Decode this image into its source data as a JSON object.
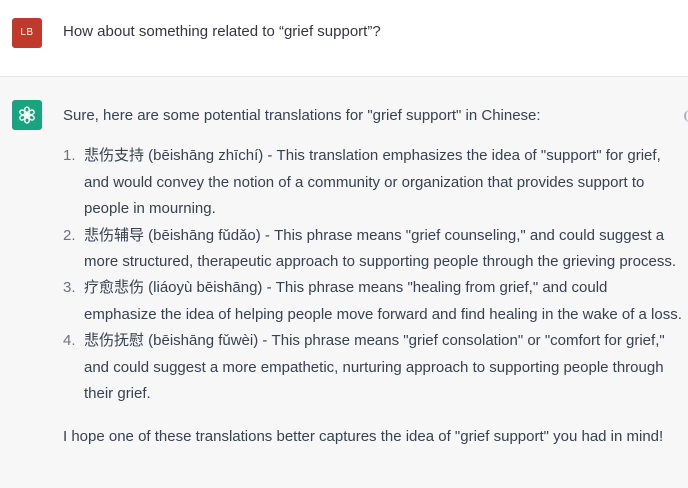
{
  "user_message": {
    "avatar_initials": "LB",
    "text": "How about something related to “grief support”?"
  },
  "assistant_message": {
    "avatar_icon": "openai-logo-icon",
    "intro": "Sure, here are some potential translations for \"grief support\" in Chinese:",
    "items": [
      {
        "number": "1.",
        "text": "悲伤支持 (bēishāng zhīchí) - This translation emphasizes the idea of \"support\" for grief, and would convey the notion of a community or organization that provides support to people in mourning."
      },
      {
        "number": "2.",
        "text": "悲伤辅导 (bēishāng fǔdǎo) - This phrase means \"grief counseling,\" and could suggest a more structured, therapeutic approach to supporting people through the grieving process."
      },
      {
        "number": "3.",
        "text": "疗愈悲伤 (liáoyù bēishāng) - This phrase means \"healing from grief,\" and could emphasize the idea of helping people move forward and find healing in the wake of a loss."
      },
      {
        "number": "4.",
        "text": "悲伤抚慰 (bēishāng fǔwèi) - This phrase means \"grief consolation\" or \"comfort for grief,\" and could suggest a more empathetic, nurturing approach to supporting people through their grief."
      }
    ],
    "outro": "I hope one of these translations better captures the idea of \"grief support\" you had in mind!"
  },
  "colors": {
    "user_avatar": "#c0392b",
    "assistant_avatar": "#19a37f",
    "assistant_background": "#f7f7f8",
    "text": "#374151"
  }
}
